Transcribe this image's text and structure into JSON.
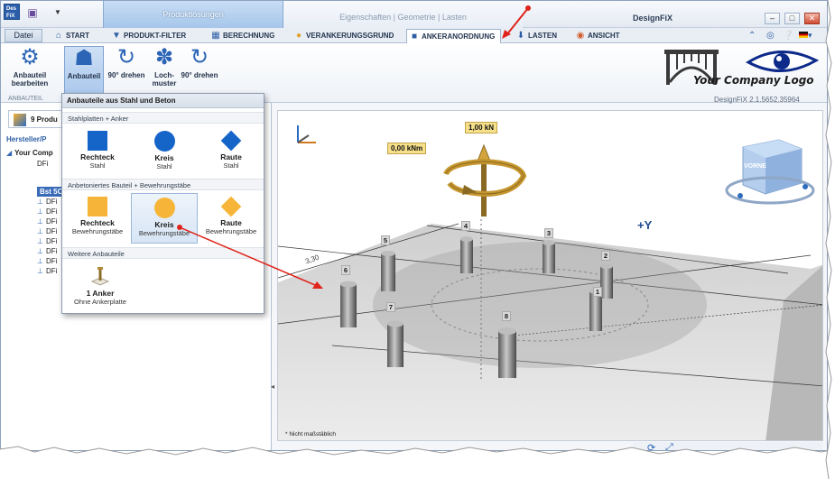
{
  "titlebar": {
    "context_group_label": "Produktlösungen",
    "context_group2_label": "Eigenschaften | Geometrie | Lasten",
    "app_title": "DesignFiX"
  },
  "tabs": [
    {
      "label": "Datei"
    },
    {
      "label": "START"
    },
    {
      "label": "PRODUKT-FILTER"
    },
    {
      "label": "BERECHNUNG"
    },
    {
      "label": "VERANKERUNGSGRUND"
    },
    {
      "label": "ANKERANORDNUNG",
      "active": true
    },
    {
      "label": "LASTEN"
    },
    {
      "label": "ANSICHT"
    }
  ],
  "ribbon": {
    "buttons": [
      {
        "label": "Anbauteil bearbeiten",
        "icon": "edit-part-icon"
      },
      {
        "label": "Anbauteil",
        "icon": "part-icon",
        "pressed": true
      },
      {
        "label": "90° drehen",
        "icon": "rotate-icon"
      },
      {
        "label": "Loch-muster",
        "icon": "hole-pattern-icon"
      },
      {
        "label": "90° drehen",
        "icon": "rotate-icon"
      }
    ],
    "group_label": "ANBAUTEIL",
    "company": "Your Company Logo",
    "version": "DesignFiX 2.1.5652.35964"
  },
  "leftpanel": {
    "tab_label": "9 Produ",
    "header": "Hersteller/P",
    "tree": [
      {
        "label": "Your Comp",
        "level": 0
      },
      {
        "label": "DFi",
        "level": 2
      },
      {
        "label": "Bst 5C",
        "level": 1,
        "selected": true
      },
      {
        "label": "DFi",
        "level": 2
      },
      {
        "label": "DFi",
        "level": 2
      },
      {
        "label": "DFi",
        "level": 2
      },
      {
        "label": "DFi",
        "level": 2
      },
      {
        "label": "DFi",
        "level": 2
      },
      {
        "label": "DFi",
        "level": 2
      },
      {
        "label": "DFi",
        "level": 2
      },
      {
        "label": "DFi",
        "level": 2
      }
    ]
  },
  "dropdown": {
    "title": "Anbauteile aus Stahl und Beton",
    "sections": [
      {
        "title": "Stahlplatten + Anker",
        "items": [
          {
            "name": "Rechteck",
            "sub": "Stahl",
            "shape": "square",
            "color": "#1565c9"
          },
          {
            "name": "Kreis",
            "sub": "Stahl",
            "shape": "circle",
            "color": "#1565c9"
          },
          {
            "name": "Raute",
            "sub": "Stahl",
            "shape": "diamond",
            "color": "#1565c9"
          }
        ]
      },
      {
        "title": "Anbetoniertes Bauteil + Bewehrungstäbe",
        "items": [
          {
            "name": "Rechteck",
            "sub": "Bewehrungstäbe",
            "shape": "square",
            "color": "#f6b538"
          },
          {
            "name": "Kreis",
            "sub": "Bewehrungstäbe",
            "shape": "circle",
            "color": "#f6b538",
            "hover": true
          },
          {
            "name": "Raute",
            "sub": "Bewehrungstäbe",
            "shape": "diamond",
            "color": "#f6b538"
          }
        ]
      },
      {
        "title": "Weitere Anbauteile",
        "items": [
          {
            "name": "1 Anker",
            "sub": "Ohne Ankerplatte",
            "shape": "anchor"
          }
        ]
      }
    ]
  },
  "viewport": {
    "force_label": "1,00 kN",
    "moment_label": "0,00 kNm",
    "axis_label": "+Y",
    "cube_label": "VORNE",
    "note": "* Nicht maßstäblich",
    "dimension": "3,30",
    "anchor_numbers": [
      "1",
      "2",
      "3",
      "4",
      "5",
      "6",
      "7",
      "8"
    ]
  }
}
